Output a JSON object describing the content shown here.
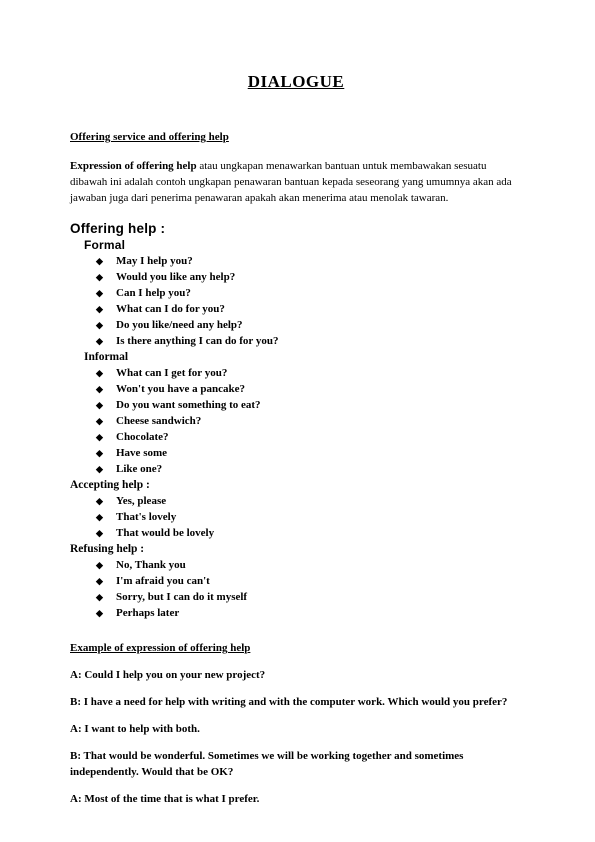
{
  "document": {
    "title": "DIALOGUE",
    "section_heading": "Offering service and offering help",
    "intro": {
      "lead": "Expression of offering help",
      "rest": " atau ungkapan menawarkan bantuan untuk membawakan sesuatu dibawah ini adalah contoh ungkapan penawaran bantuan kepada seseorang yang umumnya akan ada jawaban juga dari penerima penawaran apakah akan menerima atau menolak tawaran."
    },
    "offering_help": {
      "heading": "Offering help :",
      "formal": {
        "label": "Formal",
        "items": [
          "May I help you?",
          "Would you like any help?",
          "Can I help you?",
          "What can I do for you?",
          "Do you like/need any help?",
          "Is there anything I can do for you?"
        ]
      },
      "informal": {
        "label": "Informal",
        "items": [
          "What can I get for you?",
          "Won't you have a pancake?",
          "Do you want something to eat?",
          "Cheese sandwich?",
          "Chocolate?",
          "Have some",
          "Like one?"
        ]
      }
    },
    "accepting_help": {
      "heading": "Accepting help :",
      "items": [
        "Yes, please",
        "That's lovely",
        "That would be lovely"
      ]
    },
    "refusing_help": {
      "heading": "Refusing help :",
      "items": [
        "No, Thank you",
        "I'm afraid you can't",
        "Sorry, but I can do it myself",
        "Perhaps later"
      ]
    },
    "example": {
      "heading": "Example of expression of offering help",
      "lines": [
        "A: Could I help you on your new project?",
        "B: I have a need for help with writing and with the computer work. Which would you prefer?",
        "A: I want to help with both.",
        "B: That would be wonderful. Sometimes we will be working together and sometimes independently. Would that be OK?",
        "A: Most of the time that is what I prefer."
      ]
    },
    "bullet_glyph": "◆"
  }
}
